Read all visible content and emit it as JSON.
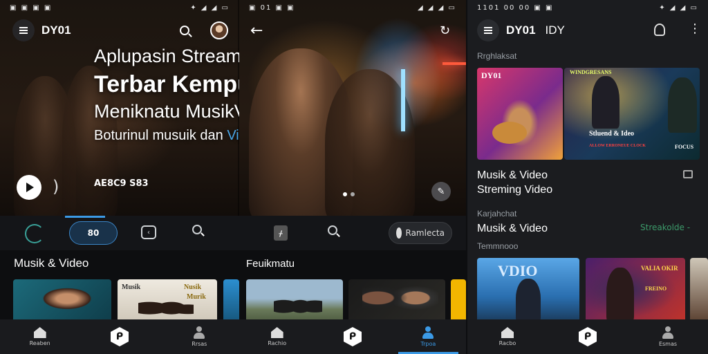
{
  "colors": {
    "accent": "#3b9ae6",
    "background": "#141518",
    "highlight_text": "#49a6e8",
    "link_green": "#3c9a6a"
  },
  "screen1": {
    "status": {
      "left": "▣ ▣ ▣ ▣",
      "right": "✦ ◢ ◢ ▭"
    },
    "app_title": "DY01",
    "hero": {
      "line1": "Aplupasin Streaming Video Videon",
      "line2": "Terbar Kempur",
      "line3": "Meniknatu MusikVideoi",
      "line4_plain": "Boturinul musuik dan ",
      "line4_accent": "Video",
      "code": "AE8C9 S83"
    },
    "tabs": {
      "active_pill": "80"
    },
    "section_title": "Musik & Video",
    "thumb_caps": [
      "Musik",
      "Nusik",
      "Murik"
    ],
    "nav": [
      {
        "label": "Reaben",
        "icon": "home-icon"
      },
      {
        "label": "",
        "icon": "hexagon-logo-icon"
      },
      {
        "label": "Rrsas",
        "icon": "person-icon"
      }
    ]
  },
  "screen2": {
    "status": {
      "left": "▣ 01 ▣ ▣",
      "right": "◢ ◢ ◢ ▭"
    },
    "tabs": {
      "grey_pill": "Ramlecta"
    },
    "section_title": "Feuikmatu",
    "nav": [
      {
        "label": "Rachio",
        "icon": "home-icon"
      },
      {
        "label": "",
        "icon": "hexagon-logo-icon"
      },
      {
        "label": "Trpoa",
        "icon": "person-icon"
      }
    ]
  },
  "screen3": {
    "status": {
      "left": "1101 00 00 ▣ ▣",
      "right": "✦ ◢ ◢ ▭"
    },
    "app_title": "DY01",
    "app_subtitle": "IDY",
    "label1": "Rrghlaksat",
    "featured": {
      "left_cap": "DY01",
      "right_cap": "WINDGRESANS",
      "center_cap": "Stluend & Ideo",
      "bottom_cap": "ALLOW ERRONEUE CLOCK",
      "badge": "FOCUS"
    },
    "featured_title_1": "Musik & Video",
    "featured_title_2": "Streming Video",
    "label2": "Karjahchat",
    "section_title": "Musik & Video",
    "section_link": "Streakolde -",
    "label3": "Temmnooo",
    "thumb_caps": [
      "VDIO",
      "VALIA OKIR",
      "FREINO"
    ],
    "nav": [
      {
        "label": "Racbo",
        "icon": "home-icon"
      },
      {
        "label": "",
        "icon": "hexagon-logo-icon"
      },
      {
        "label": "Esmas",
        "icon": "person-icon"
      }
    ]
  }
}
